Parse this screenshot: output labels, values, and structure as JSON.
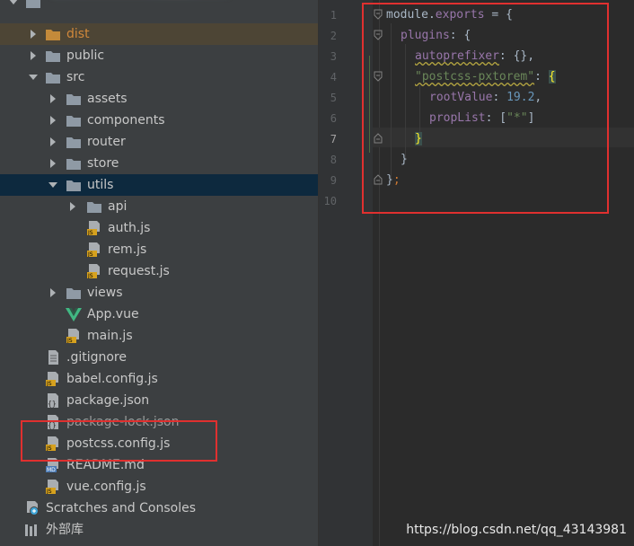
{
  "tree": {
    "items": [
      {
        "label": "dist",
        "type": "folder"
      },
      {
        "label": "public",
        "type": "folder"
      },
      {
        "label": "src",
        "type": "folder"
      },
      {
        "label": "assets",
        "type": "folder"
      },
      {
        "label": "components",
        "type": "folder"
      },
      {
        "label": "router",
        "type": "folder"
      },
      {
        "label": "store",
        "type": "folder"
      },
      {
        "label": "utils",
        "type": "folder"
      },
      {
        "label": "api",
        "type": "folder"
      },
      {
        "label": "auth.js",
        "type": "js"
      },
      {
        "label": "rem.js",
        "type": "js"
      },
      {
        "label": "request.js",
        "type": "js"
      },
      {
        "label": "views",
        "type": "folder"
      },
      {
        "label": "App.vue",
        "type": "vue"
      },
      {
        "label": "main.js",
        "type": "js"
      },
      {
        "label": ".gitignore",
        "type": "text"
      },
      {
        "label": "babel.config.js",
        "type": "js"
      },
      {
        "label": "package.json",
        "type": "json"
      },
      {
        "label": "package-lock.json",
        "type": "json"
      },
      {
        "label": "postcss.config.js",
        "type": "js"
      },
      {
        "label": "README.md",
        "type": "md"
      },
      {
        "label": "vue.config.js",
        "type": "js"
      },
      {
        "label": "Scratches and Consoles",
        "type": "scratch"
      },
      {
        "label": "外部库",
        "type": "library"
      }
    ]
  },
  "editor": {
    "line_numbers": [
      "1",
      "2",
      "3",
      "4",
      "5",
      "6",
      "7",
      "8",
      "9",
      "10"
    ],
    "code": {
      "l1_module": "module",
      "l1_dot": ".",
      "l1_exports": "exports",
      "l1_rest": " = {",
      "l2_plugins": "plugins",
      "l2_rest": ": {",
      "l3_key": "autoprefixer",
      "l3_rest": ": {},",
      "l4_key": "\"postcss-pxtorem\"",
      "l4_colon": ": ",
      "l4_brace": "{",
      "l5_key": "rootValue",
      "l5_colon": ": ",
      "l5_value": "19.2",
      "l5_comma": ",",
      "l6_key": "propList",
      "l6_colon": ": [",
      "l6_value": "\"*\"",
      "l6_close": "]",
      "l7_brace": "}",
      "l8_brace": "}",
      "l9_brace": "}",
      "l9_semi": ";"
    }
  },
  "watermark": "https://blog.csdn.net/qq_43143981",
  "colors": {
    "annotation_red": "#e0302f",
    "selected_row": "#0d293e",
    "folder_icon": "#8f9aa5"
  }
}
